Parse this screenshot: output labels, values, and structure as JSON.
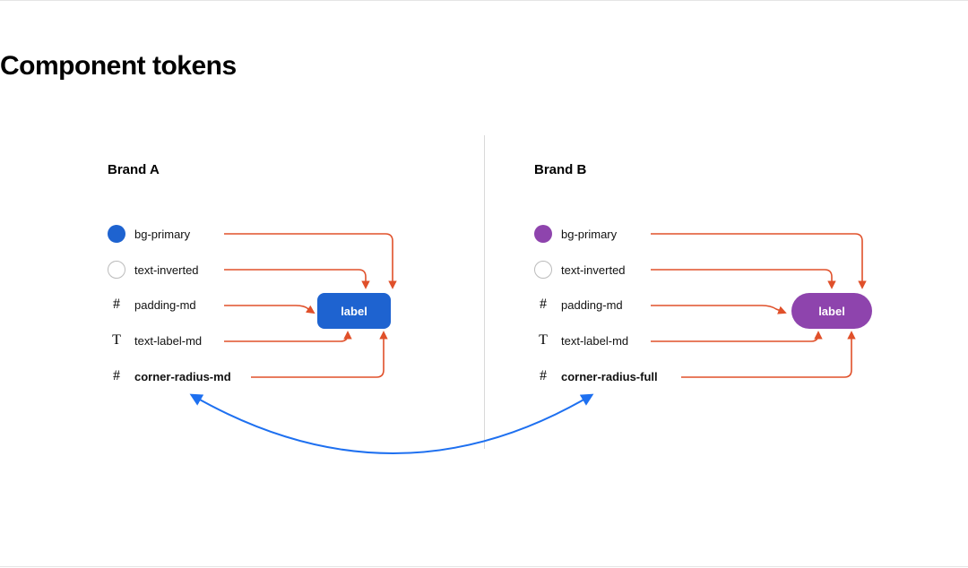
{
  "title": "Component tokens",
  "brand_a": {
    "heading": "Brand A",
    "button_label": "label",
    "primary_color": "#1e63d0",
    "tokens": {
      "bg": "bg-primary",
      "text": "text-inverted",
      "padding": "padding-md",
      "label": "text-label-md",
      "radius": "corner-radius-md"
    }
  },
  "brand_b": {
    "heading": "Brand B",
    "button_label": "label",
    "primary_color": "#8e44ad",
    "tokens": {
      "bg": "bg-primary",
      "text": "text-inverted",
      "padding": "padding-md",
      "label": "text-label-md",
      "radius": "corner-radius-full"
    }
  },
  "colors": {
    "connector": "#e0502a",
    "link": "#1e70f0"
  }
}
